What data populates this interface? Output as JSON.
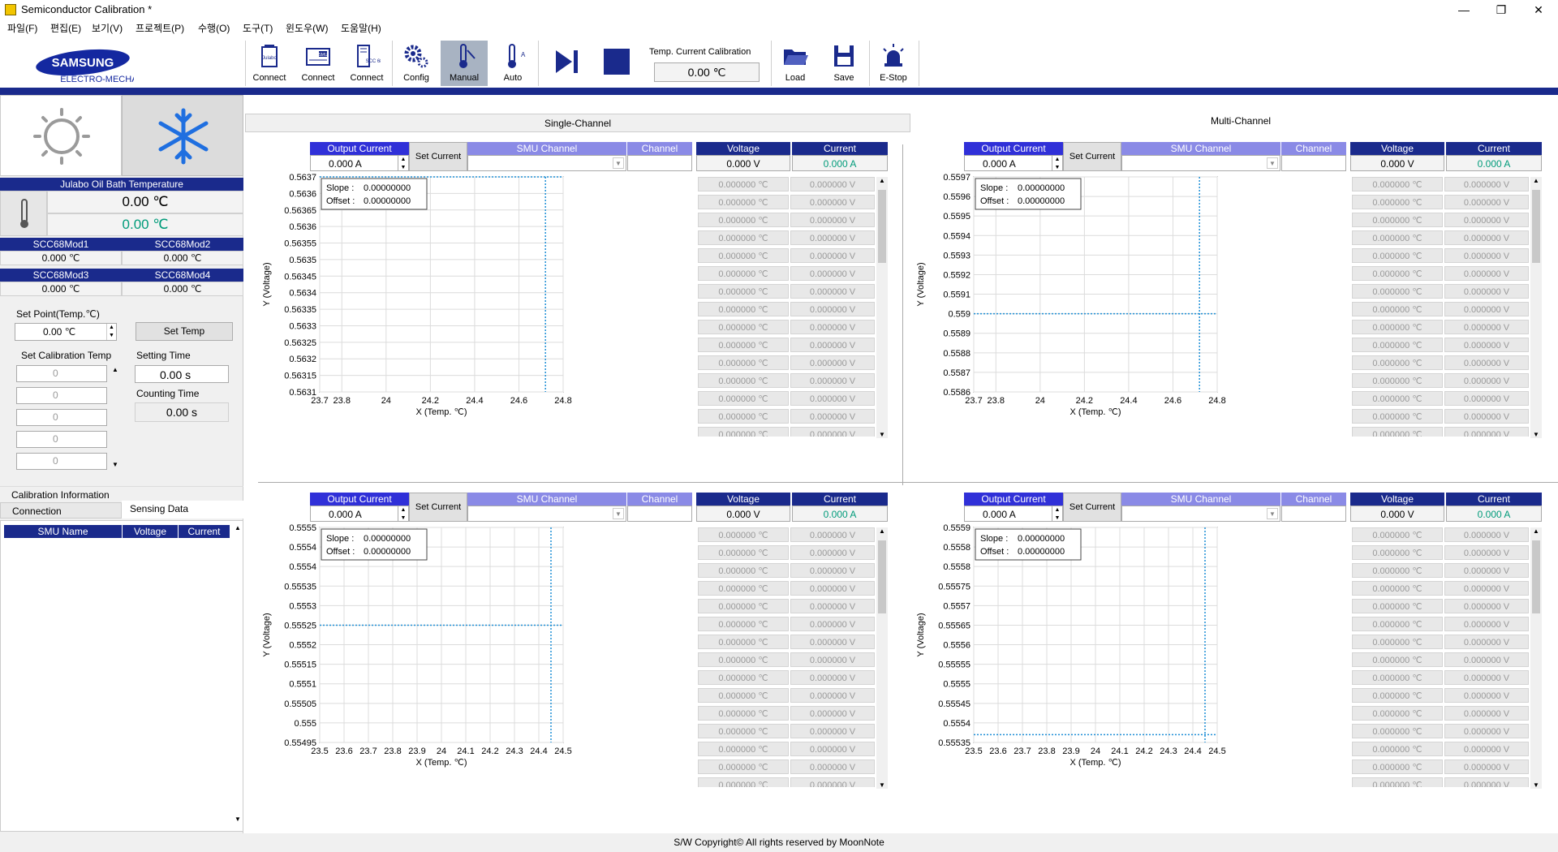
{
  "app": {
    "title": "Semiconductor Calibration *"
  },
  "window": {
    "minimize": "—",
    "restore": "❐",
    "close": "✕"
  },
  "menu": [
    "파일(F)",
    "편집(E)",
    "보기(V)",
    "프로젝트(P)",
    "수행(O)",
    "도구(T)",
    "윈도우(W)",
    "도움말(H)"
  ],
  "logo": {
    "line1": "SAMSUNG",
    "line2": "ELECTRO-MECHANICS"
  },
  "toolbar": {
    "buttons": [
      {
        "label": "Connect",
        "icon": "julabo-connect-icon",
        "tag": "Julabo"
      },
      {
        "label": "Connect",
        "icon": "smu-connect-icon",
        "tag": "SMU"
      },
      {
        "label": "Connect",
        "icon": "scc68-connect-icon",
        "tag": "SCC 68"
      },
      {
        "label": "Config",
        "icon": "gear-icon"
      },
      {
        "label": "Manual",
        "icon": "manual-thermometer-icon"
      },
      {
        "label": "Auto",
        "icon": "auto-thermometer-icon"
      },
      {
        "label": "Load",
        "icon": "folder-open-icon"
      },
      {
        "label": "Save",
        "icon": "save-disk-icon"
      },
      {
        "label": "E-Stop",
        "icon": "alarm-light-icon"
      }
    ],
    "temp_calib_label": "Temp. Current Calibration",
    "temp_calib_value": "0.00 ℃"
  },
  "left": {
    "julabo_title": "Julabo Oil Bath Temperature",
    "julabo_temp1": "0.00 ℃",
    "julabo_temp2": "0.00 ℃",
    "mods": [
      {
        "name": "SCC68Mod1",
        "value": "0.000 ℃"
      },
      {
        "name": "SCC68Mod2",
        "value": "0.000 ℃"
      },
      {
        "name": "SCC68Mod3",
        "value": "0.000 ℃"
      },
      {
        "name": "SCC68Mod4",
        "value": "0.000 ℃"
      }
    ],
    "set_point_label": "Set Point(Temp.℃)",
    "set_point_value": "0.00 ℃",
    "set_temp_btn": "Set Temp",
    "set_calib_label": "Set Calibration Temp",
    "calib_values": [
      "0",
      "0",
      "0",
      "0",
      "0"
    ],
    "setting_time_label": "Setting Time",
    "setting_time_value": "0.00 s",
    "counting_time_label": "Counting Time",
    "counting_time_value": "0.00 s",
    "calib_info_label": "Calibration Information",
    "tabs": [
      "Connection",
      "Sensing Data"
    ],
    "smu_table_headers": [
      "SMU Name",
      "Voltage",
      "Current"
    ]
  },
  "tabs": {
    "single": "Single-Channel",
    "multi": "Multi-Channel"
  },
  "panel_labels": {
    "output_current": "Output Current",
    "set_current": "Set Current",
    "smu_channel": "SMU Channel",
    "channel": "Channel",
    "voltage": "Voltage",
    "current": "Current",
    "output_value": "0.000 A",
    "voltage_value": "0.000 V",
    "current_value": "0.000 A",
    "slope_label": "Slope :",
    "offset_label": "Offset :",
    "slope_value": "0.00000000",
    "offset_value": "0.00000000",
    "temp_cell": "0.000000 ℃",
    "volt_cell": "0.000000 V"
  },
  "colors": {
    "accent": "#1a2a8c",
    "header_blue": "#3030d8",
    "header_light": "#8a8ae6",
    "current_green": "#009b7a",
    "cursor": "#1f8fd6"
  },
  "chart_data": [
    {
      "type": "line",
      "xlabel": "X (Temp. ℃)",
      "ylabel": "Y (Voltage)",
      "xlim": [
        23.7,
        24.8
      ],
      "xticks": [
        "23.7",
        "23.8",
        "24",
        "24.2",
        "24.4",
        "24.6",
        "24.8"
      ],
      "yticks": [
        "0.5637",
        "0.5636",
        "0.56365",
        "0.5636",
        "0.56355",
        "0.5635",
        "0.56345",
        "0.5634",
        "0.56335",
        "0.5633",
        "0.56325",
        "0.5632",
        "0.56315",
        "0.5631"
      ],
      "cursor": {
        "x": 24.72,
        "y": 0.5637
      }
    },
    {
      "type": "line",
      "xlabel": "X (Temp. ℃)",
      "ylabel": "Y (Voltage)",
      "xlim": [
        23.7,
        24.8
      ],
      "xticks": [
        "23.7",
        "23.8",
        "24",
        "24.2",
        "24.4",
        "24.6",
        "24.8"
      ],
      "yticks": [
        "0.5597",
        "0.5596",
        "0.5595",
        "0.5594",
        "0.5593",
        "0.5592",
        "0.5591",
        "0.559",
        "0.5589",
        "0.5588",
        "0.5587",
        "0.5586"
      ],
      "cursor": {
        "x": 24.72,
        "y": 0.559
      }
    },
    {
      "type": "line",
      "xlabel": "X (Temp. ℃)",
      "ylabel": "Y (Voltage)",
      "xlim": [
        23.5,
        24.5
      ],
      "xticks": [
        "23.5",
        "23.6",
        "23.7",
        "23.8",
        "23.9",
        "24",
        "24.1",
        "24.2",
        "24.3",
        "24.4",
        "24.5"
      ],
      "yticks": [
        "0.5555",
        "0.5554",
        "0.5554",
        "0.55535",
        "0.5553",
        "0.55525",
        "0.5552",
        "0.55515",
        "0.5551",
        "0.55505",
        "0.555",
        "0.55495"
      ],
      "cursor": {
        "x": 24.45,
        "y": 0.55525
      }
    },
    {
      "type": "line",
      "xlabel": "X (Temp. ℃)",
      "ylabel": "Y (Voltage)",
      "xlim": [
        23.5,
        24.5
      ],
      "xticks": [
        "23.5",
        "23.6",
        "23.7",
        "23.8",
        "23.9",
        "24",
        "24.1",
        "24.2",
        "24.3",
        "24.4",
        "24.5"
      ],
      "yticks": [
        "0.5559",
        "0.5558",
        "0.5558",
        "0.55575",
        "0.5557",
        "0.55565",
        "0.5556",
        "0.55555",
        "0.5555",
        "0.55545",
        "0.5554",
        "0.55535"
      ],
      "cursor": {
        "x": 24.45,
        "y": 0.55537
      }
    }
  ],
  "footer": "S/W Copyright© All rights reserved by MoonNote"
}
